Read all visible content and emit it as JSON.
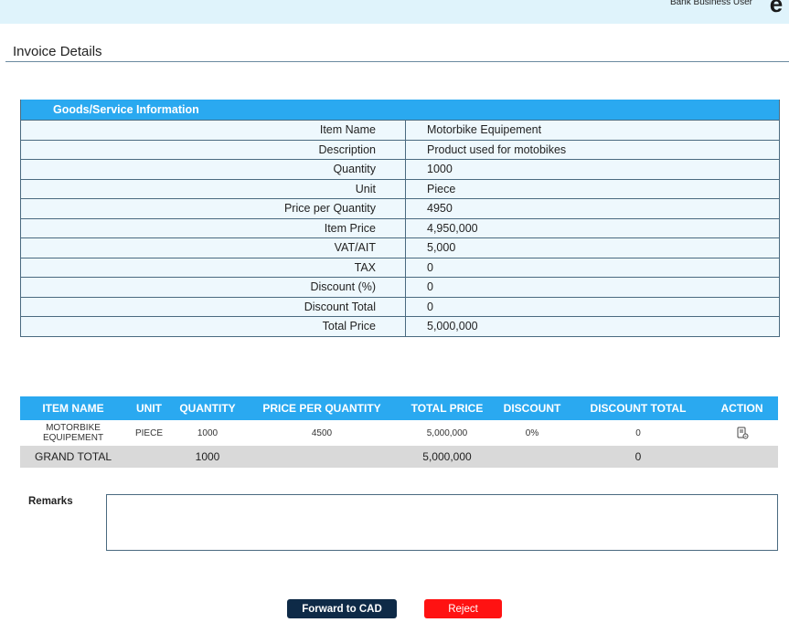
{
  "topbar": {
    "user_role": "Bank Business User",
    "avatar_glyph": "e"
  },
  "page": {
    "title": "Invoice Details"
  },
  "goods": {
    "header": "Goods/Service Information",
    "rows": [
      {
        "label": "Item Name",
        "value": "Motorbike Equipement"
      },
      {
        "label": "Description",
        "value": "Product used for motobikes"
      },
      {
        "label": "Quantity",
        "value": "1000"
      },
      {
        "label": "Unit",
        "value": "Piece"
      },
      {
        "label": "Price per Quantity",
        "value": "4950"
      },
      {
        "label": "Item Price",
        "value": "4,950,000"
      },
      {
        "label": "VAT/AIT",
        "value": "5,000"
      },
      {
        "label": "TAX",
        "value": "0"
      },
      {
        "label": "Discount (%)",
        "value": "0"
      },
      {
        "label": "Discount Total",
        "value": "0"
      },
      {
        "label": "Total Price",
        "value": "5,000,000"
      }
    ]
  },
  "items": {
    "columns": [
      "ITEM NAME",
      "UNIT",
      "QUANTITY",
      "PRICE PER QUANTITY",
      "TOTAL PRICE",
      "DISCOUNT",
      "DISCOUNT TOTAL",
      "ACTION"
    ],
    "rows": [
      {
        "item_name": "MOTORBIKE EQUIPEMENT",
        "unit": "PIECE",
        "quantity": "1000",
        "price_per_quantity": "4500",
        "total_price": "5,000,000",
        "discount": "0%",
        "discount_total": "0",
        "action_icon": "edit-document-icon"
      }
    ],
    "grand_total": {
      "label": "GRAND TOTAL",
      "quantity": "1000",
      "total_price": "5,000,000",
      "discount_total": "0"
    }
  },
  "remarks": {
    "label": "Remarks",
    "value": ""
  },
  "buttons": {
    "forward_label": "Forward to CAD",
    "reject_label": "Reject"
  },
  "colors": {
    "accent": "#2aa9f0",
    "topbar_bg": "#dff3fb",
    "forward_button": "#0e2a47",
    "reject_button": "#ff1212",
    "total_row_bg": "#d9d9d9"
  }
}
